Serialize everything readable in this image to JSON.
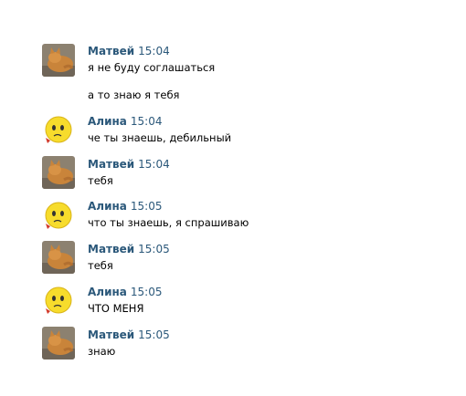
{
  "users": {
    "matvey": {
      "name": "Матвей",
      "avatar_icon": "cat-photo-icon"
    },
    "alina": {
      "name": "Алина",
      "avatar_icon": "sad-smiley-icon"
    }
  },
  "messages": [
    {
      "author": "Матвей",
      "time": "15:04",
      "lines": [
        "я не буду соглашаться",
        "а то знаю я тебя"
      ]
    },
    {
      "author": "Алина",
      "time": "15:04",
      "lines": [
        "че ты знаешь, дебильный"
      ]
    },
    {
      "author": "Матвей",
      "time": "15:04",
      "lines": [
        "тебя"
      ]
    },
    {
      "author": "Алина",
      "time": "15:05",
      "lines": [
        "что ты знаешь, я спрашиваю"
      ]
    },
    {
      "author": "Матвей",
      "time": "15:05",
      "lines": [
        "тебя"
      ]
    },
    {
      "author": "Алина",
      "time": "15:05",
      "lines": [
        "ЧТО МЕНЯ"
      ]
    },
    {
      "author": "Матвей",
      "time": "15:05",
      "lines": [
        "знаю"
      ]
    }
  ],
  "colors": {
    "author": "#2b587a",
    "text": "#000000",
    "background": "#ffffff"
  }
}
